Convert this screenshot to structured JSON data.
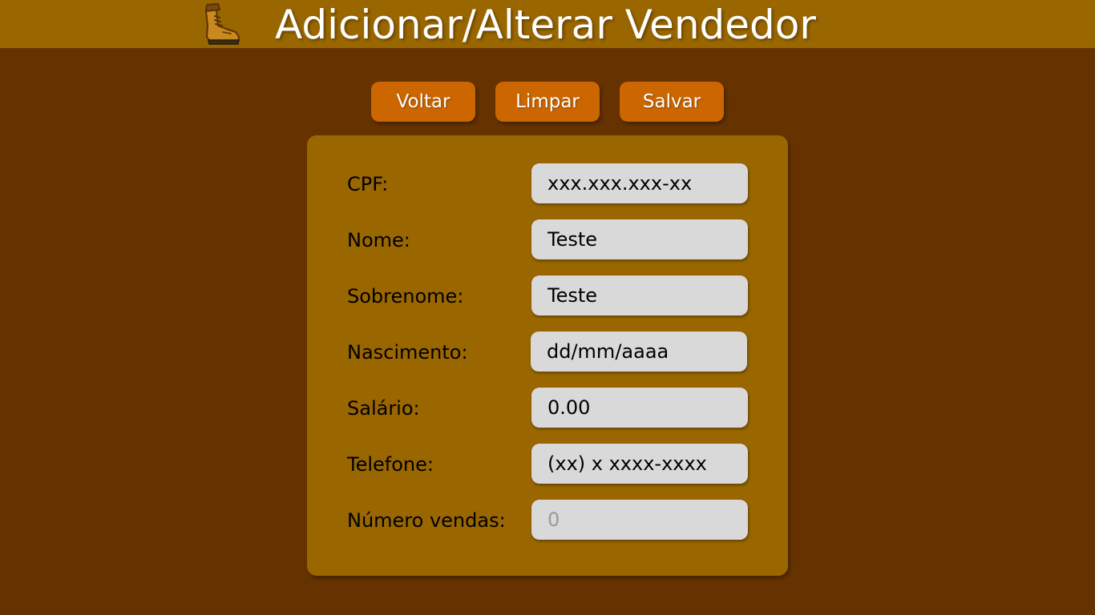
{
  "header": {
    "title": "Adicionar/Alterar Vendedor",
    "logo_icon": "boot-icon",
    "background": "#996600"
  },
  "actions": {
    "voltar_label": "Voltar",
    "limpar_label": "Limpar",
    "salvar_label": "Salvar",
    "button_color": "#cc6600"
  },
  "form": {
    "cpf": {
      "label": "CPF:",
      "value": "xxx.xxx.xxx-xx"
    },
    "nome": {
      "label": "Nome:",
      "value": "Teste"
    },
    "sobrenome": {
      "label": "Sobrenome:",
      "value": "Teste"
    },
    "nascimento": {
      "label": "Nascimento:",
      "value": "dd/mm/aaaa"
    },
    "salario": {
      "label": "Salário:",
      "value": "0.00"
    },
    "telefone": {
      "label": "Telefone:",
      "value": "(xx) x xxxx-xxxx"
    },
    "numero_vendas": {
      "label": "Número vendas:",
      "placeholder": "0"
    }
  },
  "colors": {
    "page_background": "#663300",
    "panel_background": "#996600",
    "field_background": "#d9d9d9"
  }
}
